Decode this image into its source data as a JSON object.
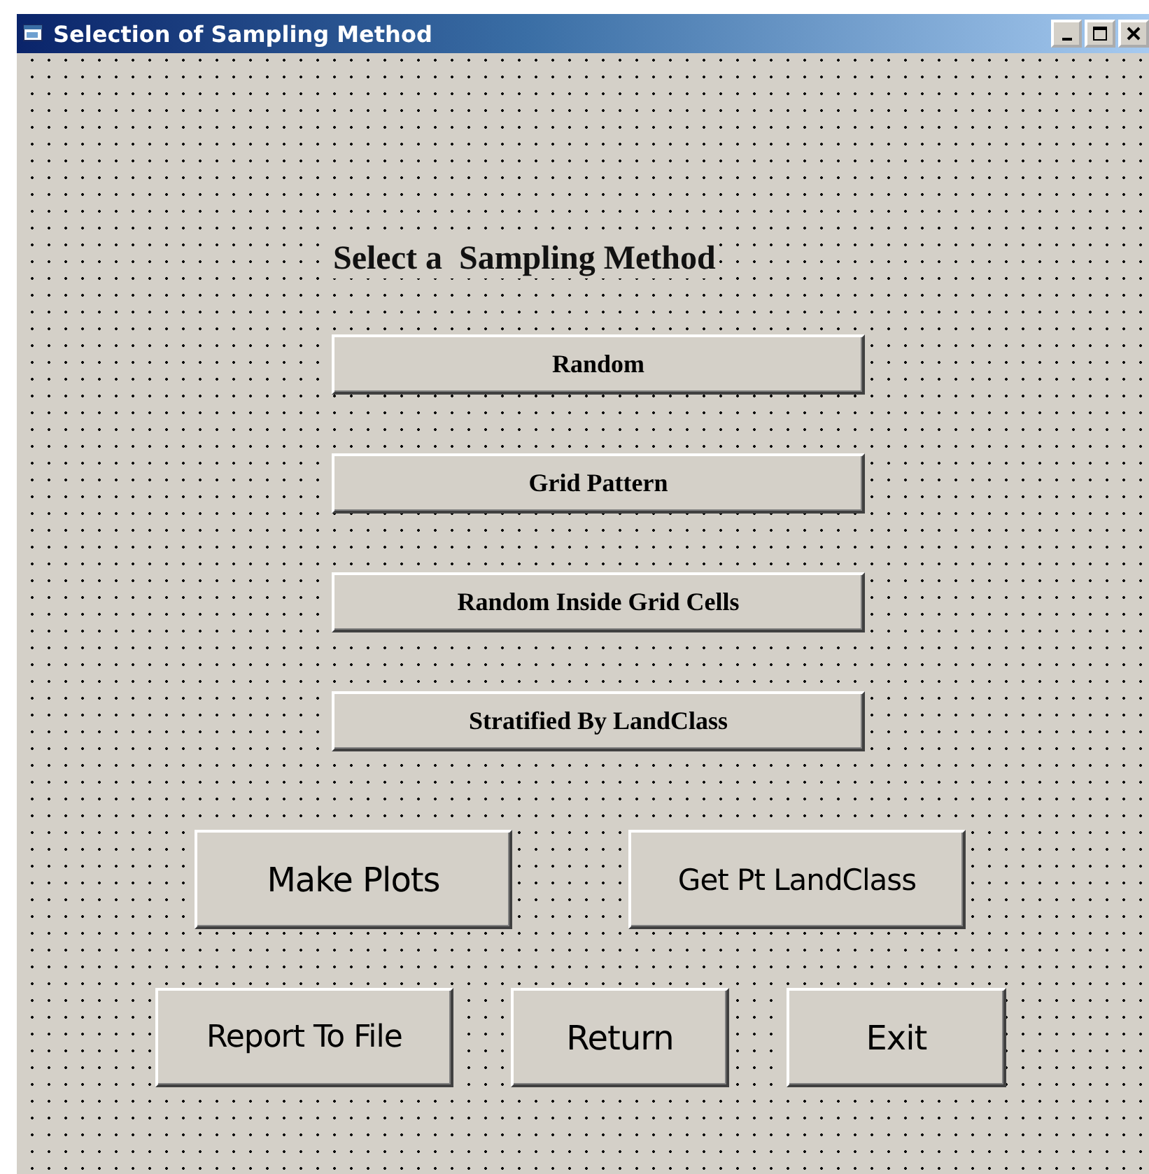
{
  "window": {
    "title": "Selection of Sampling Method"
  },
  "heading": "Select a  Sampling Method",
  "method_buttons": [
    "Random",
    "Grid Pattern",
    "Random Inside Grid Cells",
    "Stratified By LandClass"
  ],
  "action_rows": [
    {
      "buttons": [
        "Make Plots",
        "Get Pt LandClass"
      ]
    },
    {
      "buttons": [
        "Report To File",
        "Return",
        "Exit"
      ]
    }
  ]
}
